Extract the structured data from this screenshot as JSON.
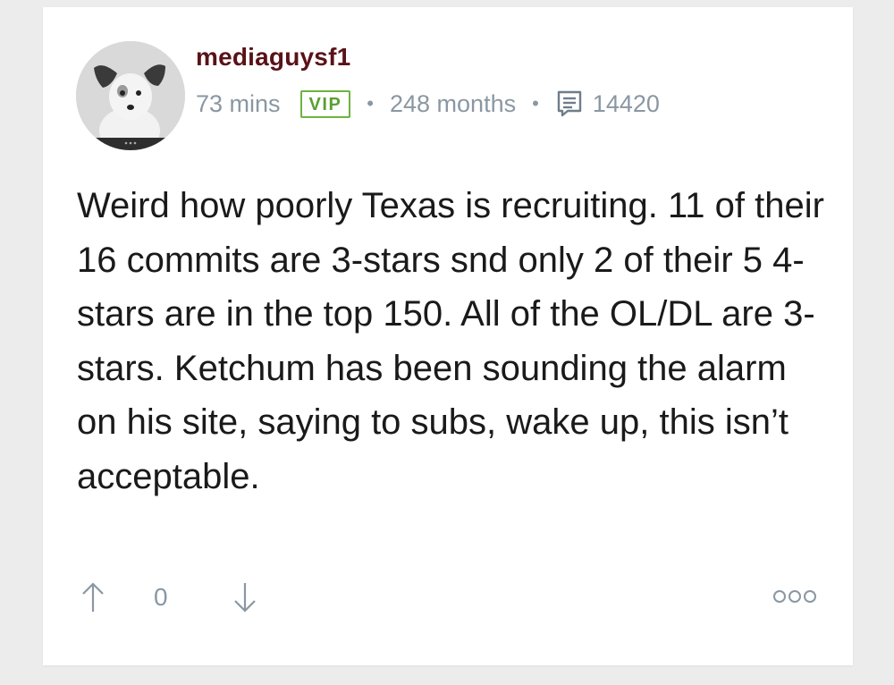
{
  "post": {
    "username": "mediaguysf1",
    "time_ago": "73 mins",
    "badge": "VIP",
    "separator": "•",
    "member_duration": "248 months",
    "comment_count": "14420",
    "body": "Weird how poorly Texas is recruiting. 11 of their 16 commits are 3-stars snd only 2 of their 5 4-stars are in the top 150. All of the OL/DL are 3-stars. Ketchum has been sounding the alarm on his site, saying to subs, wake up, this isn’t acceptable.",
    "vote_score": "0"
  },
  "icons": {
    "avatar": "dog-avatar",
    "comments": "comments-icon",
    "upvote": "arrow-up-icon",
    "downvote": "arrow-down-icon",
    "more": "more-options-icon"
  },
  "colors": {
    "username": "#5a1218",
    "vip_badge": "#6db33f",
    "meta_text": "#8a97a3",
    "body_text": "#1a1a1a",
    "background": "#ececec"
  }
}
